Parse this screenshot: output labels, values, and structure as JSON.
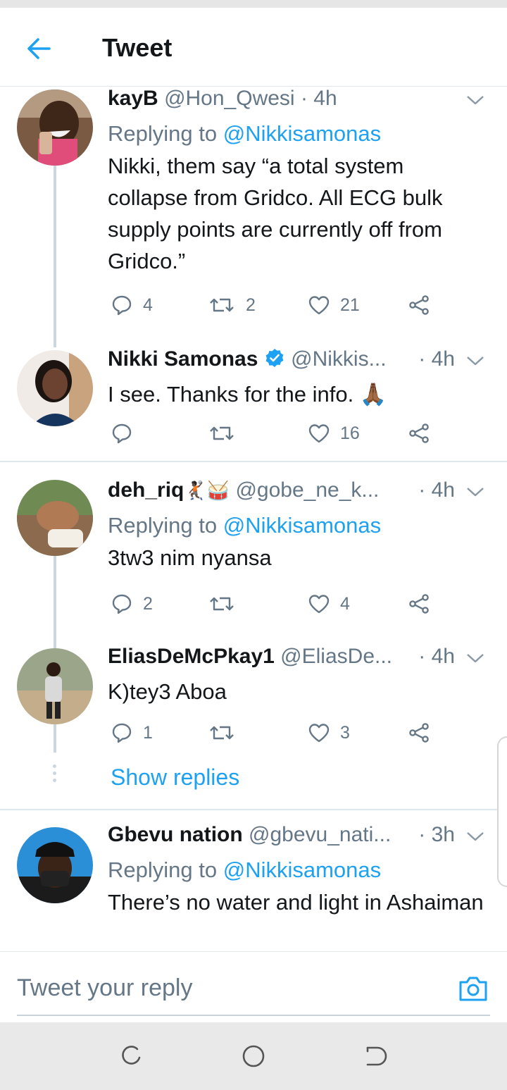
{
  "header": {
    "title": "Tweet"
  },
  "tweets": [
    {
      "name": "kayB",
      "handle": "@Hon_Qwesi",
      "time": "· 4h",
      "replying_prefix": "Replying to ",
      "replying_to": "@Nikkisamonas",
      "text": "Nikki, them say “a total system collapse from Gridco. All ECG bulk supply points are currently off from Gridco.”",
      "replies": "4",
      "retweets": "2",
      "likes": "21"
    },
    {
      "name": "Nikki Samonas",
      "verified": true,
      "handle": "@Nikkis...",
      "time": "· 4h",
      "text": "I see. Thanks for the info. 🙏🏾",
      "replies": "",
      "retweets": "",
      "likes": "16"
    },
    {
      "name": "deh_riq",
      "emojis": "🤾🏿🥁",
      "handle": "@gobe_ne_k...",
      "time": "· 4h",
      "replying_prefix": "Replying to ",
      "replying_to": "@Nikkisamonas",
      "text": "3tw3 nim nyansa",
      "replies": "2",
      "retweets": "",
      "likes": "4"
    },
    {
      "name": "EliasDeMcPkay1",
      "handle": "@EliasDe...",
      "time": "· 4h",
      "text": "K)tey3 Aboa",
      "replies": "1",
      "retweets": "",
      "likes": "3"
    },
    {
      "name": "Gbevu nation",
      "handle": "@gbevu_nati...",
      "time": "· 3h",
      "replying_prefix": "Replying to ",
      "replying_to": "@Nikkisamonas",
      "text": "There’s no water and light in Ashaiman"
    }
  ],
  "show_replies_label": "Show replies",
  "reply_box": {
    "placeholder": "Tweet your reply"
  },
  "icons": {
    "back": "arrow-left-icon",
    "caret": "chevron-down-icon",
    "reply": "speech-bubble-icon",
    "retweet": "retweet-icon",
    "like": "heart-icon",
    "share": "share-icon",
    "camera": "camera-icon",
    "verified": "verified-badge-icon"
  },
  "colors": {
    "accent": "#1da1f2",
    "secondary_text": "#657786",
    "primary_text": "#14171a"
  }
}
